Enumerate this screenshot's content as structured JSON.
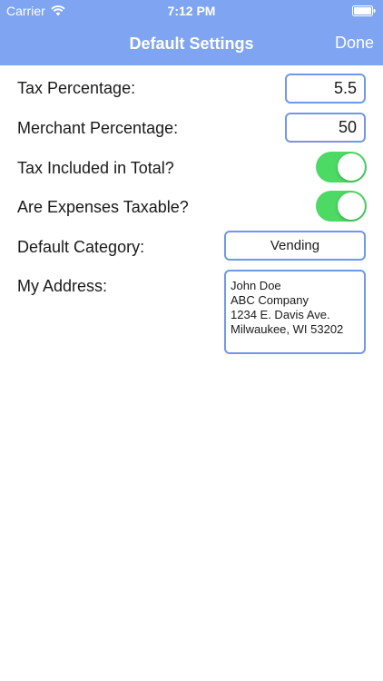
{
  "status_bar": {
    "carrier": "Carrier",
    "time": "7:12 PM",
    "wifi_icon": "wifi-icon",
    "battery_icon": "battery-icon"
  },
  "navbar": {
    "title": "Default Settings",
    "done_label": "Done",
    "color": "#7fa4f1"
  },
  "settings": {
    "tax_percentage": {
      "label": "Tax Percentage:",
      "value": "5.5"
    },
    "merchant_percentage": {
      "label": "Merchant Percentage:",
      "value": "50"
    },
    "tax_included": {
      "label": "Tax Included in Total?",
      "on": true
    },
    "expenses_taxable": {
      "label": "Are Expenses Taxable?",
      "on": true
    },
    "default_category": {
      "label": "Default Category:",
      "value": "Vending"
    },
    "address": {
      "label": "My Address:",
      "value": "John Doe\nABC Company\n1234 E. Davis Ave.\nMilwaukee, WI 53202"
    }
  },
  "colors": {
    "toggle_on": "#4cd964",
    "field_border": "#6f97ea"
  }
}
